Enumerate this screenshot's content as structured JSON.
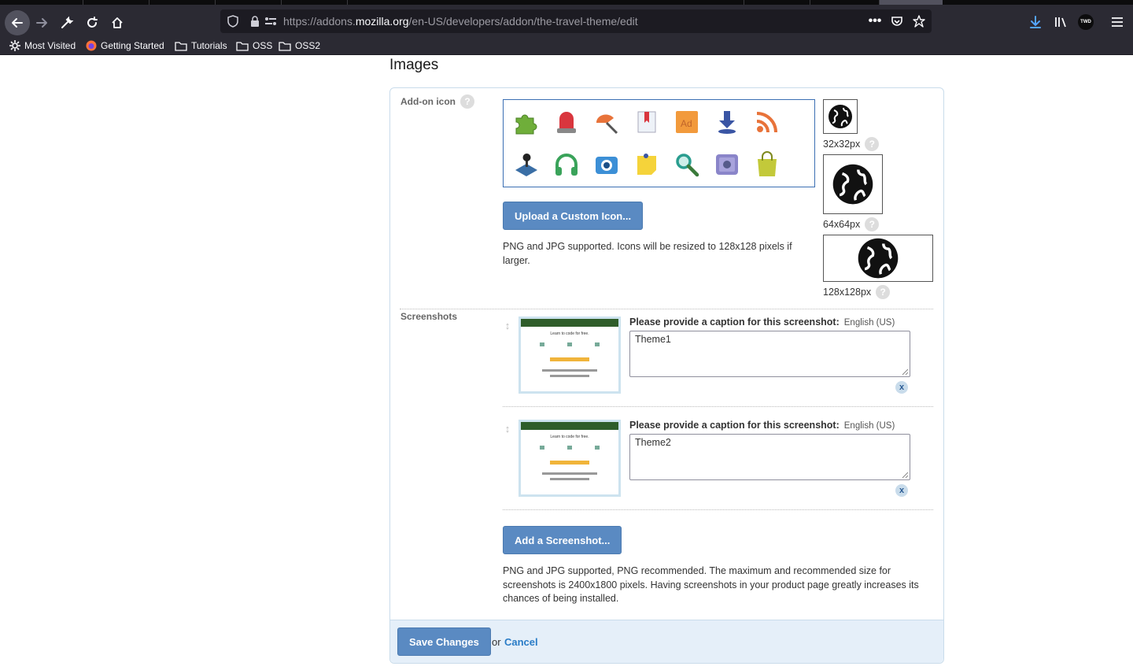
{
  "browser": {
    "url_prefix": "https://addons.",
    "url_domain": "mozilla.org",
    "url_path": "/en-US/developers/addon/the-travel-theme/edit",
    "avatar_text": "TWD",
    "bookmarks": [
      {
        "label": "Most Visited",
        "icon": "gear-icon"
      },
      {
        "label": "Getting Started",
        "icon": "firefox-icon"
      },
      {
        "label": "Tutorials",
        "icon": "folder-icon"
      },
      {
        "label": "OSS",
        "icon": "folder-icon"
      },
      {
        "label": "OSS2",
        "icon": "folder-icon"
      }
    ]
  },
  "page": {
    "section_title": "Images",
    "addon_icon": {
      "label": "Add-on icon",
      "help": "?",
      "upload_button": "Upload a Custom Icon...",
      "note": "PNG and JPG supported. Icons will be resized to 128x128 pixels if larger.",
      "icons": [
        "puzzle-icon",
        "alarm-icon",
        "paint-brush-icon",
        "bookmark-icon",
        "dictionary-icon",
        "download-icon",
        "rss-icon",
        "joystick-icon",
        "headphones-icon",
        "camera-icon",
        "sticky-note-icon",
        "magnifier-icon",
        "safe-icon",
        "shopping-bag-icon"
      ],
      "sizes": [
        {
          "label": "32x32px",
          "help": "?"
        },
        {
          "label": "64x64px",
          "help": "?"
        },
        {
          "label": "128x128px",
          "help": "?"
        }
      ]
    },
    "screenshots": {
      "label": "Screenshots",
      "caption_prompt": "Please provide a caption for this screenshot:",
      "locale": "English (US)",
      "items": [
        {
          "caption": "Theme1",
          "delete": "x",
          "thumb_heading": "Learn to code for free."
        },
        {
          "caption": "Theme2",
          "delete": "x",
          "thumb_heading": "Learn to code for free."
        }
      ],
      "add_button": "Add a Screenshot...",
      "note": "PNG and JPG supported, PNG recommended. The maximum and recommended size for screenshots is 2400x1800 pixels. Having screenshots in your product page greatly increases its chances of being installed."
    },
    "footer": {
      "save_button": "Save Changes",
      "or_text": "or",
      "cancel_link": "Cancel"
    }
  }
}
